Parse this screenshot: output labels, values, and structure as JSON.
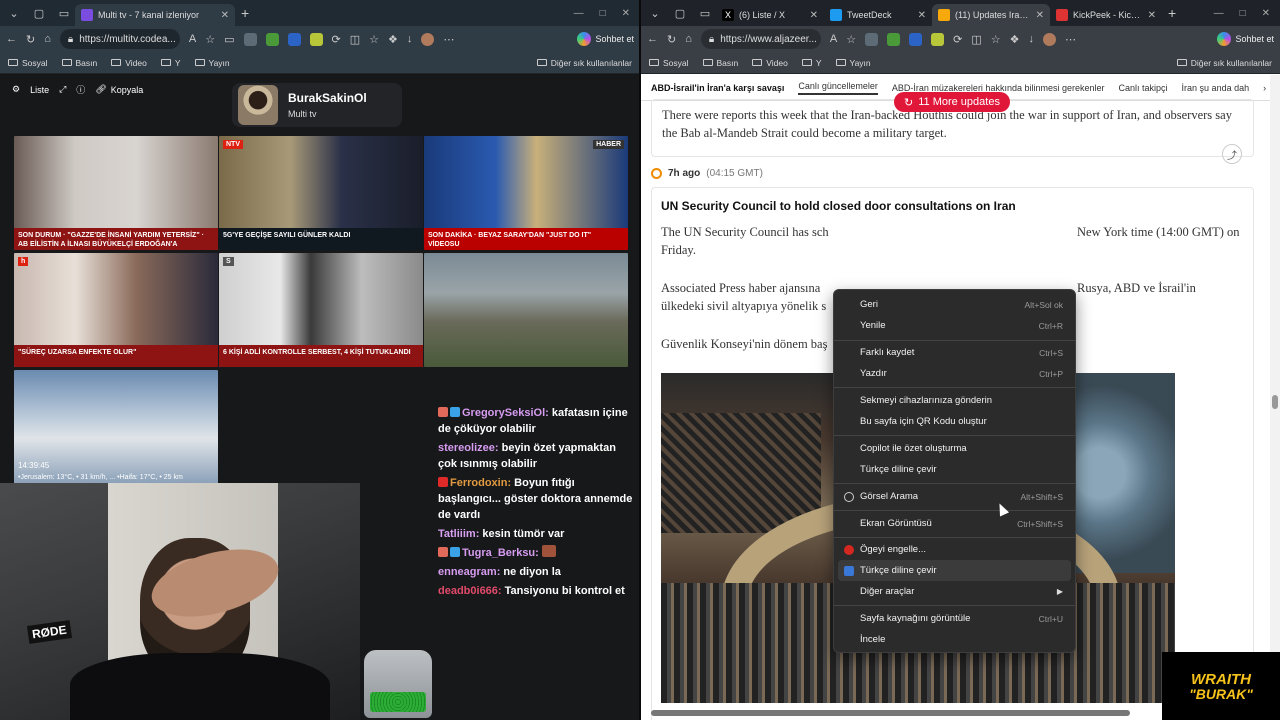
{
  "left_window": {
    "tabs": [
      {
        "title": "Multi tv - 7 kanal izleniyor",
        "active": true
      }
    ],
    "address": "https://multitv.codea...",
    "copilot_label": "Sohbet et",
    "bookmarks": [
      "Sosyal",
      "Basın",
      "Video",
      "Y",
      "Yayın"
    ],
    "bookmarks_right": "Diğer sık kullanılanlar",
    "multitv_buttons": {
      "list": "Liste",
      "copy": "Kopyala"
    },
    "profile": {
      "name": "BurakSakinOl",
      "sub": "Multi tv"
    },
    "channels": [
      {
        "logo": "",
        "ticker": "SON DURUM · \"GAZZE'DE İNSANİ YARDIM YETERSİZ\" · AB EİLİSTİN A İLNASI BÜYÜKELÇİ ERDOĞAN'A CUMHURBAŞKANI"
      },
      {
        "logo": "NTV",
        "ticker": "5G'YE GEÇİŞE SAYILI GÜNLER KALDI"
      },
      {
        "logo": "HABER",
        "ticker": "SON DAKİKA · BEYAZ SARAY'DAN \"JUST DO IT\" VİDEOSU"
      },
      {
        "logo": "h",
        "ticker": "\"SÜREÇ UZARSA ENFEKTE OLUR\""
      },
      {
        "logo": "S",
        "ticker": "6 KİŞİ ADLİ KONTROLLE SERBEST, 4 KİŞİ TUTUKLANDI"
      },
      {
        "logo": "",
        "ticker": ""
      },
      {
        "logo": "",
        "ticker": ""
      }
    ],
    "weather": {
      "time": "14:39:45",
      "line": "•Jerusalem: 13°C, • 31 km/h, ... •Haifa: 17°C, • 25 km"
    },
    "chat": [
      {
        "user": "GregorySeksiOl",
        "user_color": "#d69cf0",
        "text": " kafatasın içine de çöküyor olabilir",
        "badges": [
          "#e26a5b",
          "#3aa3e8"
        ]
      },
      {
        "user": "stereolizee",
        "user_color": "#d69cf0",
        "text": " beyin özet yapmaktan çok ısınmış olabilir",
        "badges": []
      },
      {
        "user": "Ferrodoxin",
        "user_color": "#e29a40",
        "text": " Boyun fıtığı başlangıcı... göster doktora annemde de vardı",
        "badges": [
          "#e02a2a"
        ]
      },
      {
        "user": "Tatliiim",
        "user_color": "#d7a0f0",
        "text": " kesin tümör var",
        "badges": []
      },
      {
        "user": "Tugra_Berksu",
        "user_color": "#d69cf0",
        "text": " ",
        "badges": [
          "#e26a5b",
          "#3aa3e8"
        ]
      },
      {
        "user": "enneagram",
        "user_color": "#d69cf0",
        "text": " ne diyon la",
        "badges": []
      },
      {
        "user": "deadb0i666",
        "user_color": "#e24a6a",
        "text": " Tansiyonu bi kontrol et",
        "badges": []
      }
    ],
    "cam": {
      "mic_label": "RØDE"
    }
  },
  "right_window": {
    "tabs": [
      {
        "title": "(6) Liste / X",
        "active": false
      },
      {
        "title": "TweetDeck",
        "active": false
      },
      {
        "title": "(11) Updates Iran wa...",
        "active": true
      },
      {
        "title": "KickPeek - Kick.com",
        "active": false
      }
    ],
    "address": "https://www.aljazeer...",
    "copilot_label": "Sohbet et",
    "bookmarks": [
      "Sosyal",
      "Basın",
      "Video",
      "Y",
      "Yayın"
    ],
    "bookmarks_right": "Diğer sık kullanılanlar",
    "nav": [
      "ABD-İsrail'in İran'a karşı savaşı",
      "Canlı güncellemeler",
      "ABD-İran müzakereleri hakkında bilinmesi gerekenler",
      "Canlı takipçi",
      "İran şu anda dah"
    ],
    "updates_pill": "11 More updates",
    "article_top": "There were reports this week that the Iran-backed Houthis could join the war in support of Iran, and observers say the Bab al-Mandeb Strait could become a military target.",
    "time": {
      "ago": "7h ago",
      "gmt": "(04:15 GMT)"
    },
    "headline": "UN Security Council to hold closed door consultations on Iran",
    "para1a": "The UN Security Council has sch",
    "para1b": "New York time (14:00 GMT) on",
    "para1c": "Friday.",
    "para2a": "Associated Press haber ajansına",
    "para2b": "Rusya, ABD ve İsrail'in",
    "para2c": "ülkedeki sivil altyapıya yönelik s",
    "para3": "Güvenlik Konseyi'nin dönem baş"
  },
  "context_menu": [
    {
      "label": "Geri",
      "shortcut": "Alt+Sol ok"
    },
    {
      "label": "Yenile",
      "shortcut": "Ctrl+R"
    },
    {
      "label": "Farklı kaydet",
      "shortcut": "Ctrl+S"
    },
    {
      "label": "Yazdır",
      "shortcut": "Ctrl+P"
    },
    {
      "label": "Sekmeyi cihazlarınıza gönderin",
      "shortcut": ""
    },
    {
      "label": "Bu sayfa için QR Kodu oluştur",
      "shortcut": ""
    },
    {
      "label": "Copilot ile özet oluşturma",
      "shortcut": ""
    },
    {
      "label": "Türkçe diline çevir",
      "shortcut": ""
    },
    {
      "label": "Görsel Arama",
      "shortcut": "Alt+Shift+S"
    },
    {
      "label": "Ekran Görüntüsü",
      "shortcut": "Ctrl+Shift+S"
    },
    {
      "label": "Ögeyi engelle...",
      "shortcut": ""
    },
    {
      "label": "Türkçe diline çevir",
      "shortcut": ""
    },
    {
      "label": "Diğer araçlar",
      "shortcut": ""
    },
    {
      "label": "Sayfa kaynağını görüntüle",
      "shortcut": "Ctrl+U"
    },
    {
      "label": "İncele",
      "shortcut": ""
    }
  ],
  "overlay": {
    "brand1": "WRAITH",
    "brand2": "\"BURAK\""
  },
  "colors": {
    "accent_red": "#e1173a",
    "menu_bg": "#2b2b2b",
    "tab_bar_left": "#202a33"
  }
}
